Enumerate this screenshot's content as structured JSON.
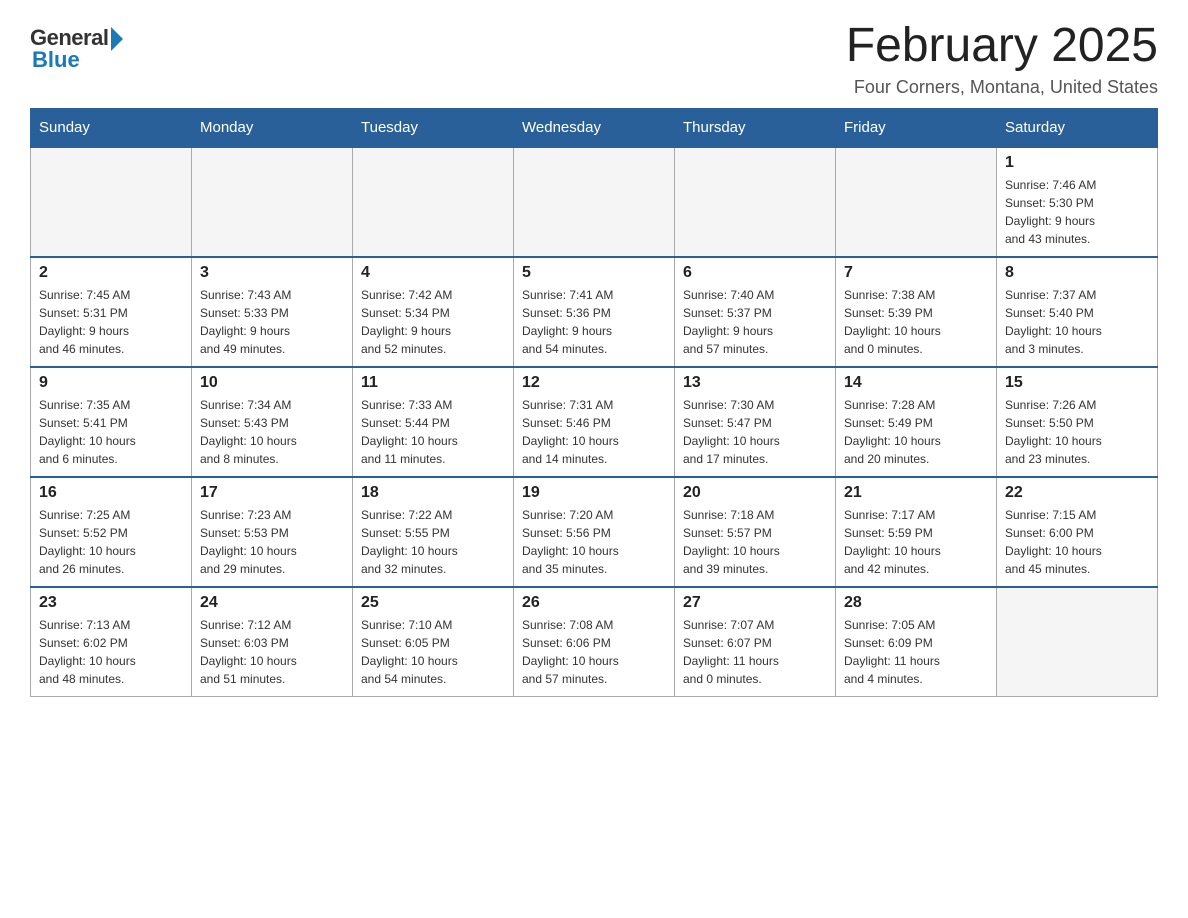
{
  "logo": {
    "general": "General",
    "blue": "Blue"
  },
  "title": "February 2025",
  "subtitle": "Four Corners, Montana, United States",
  "days_of_week": [
    "Sunday",
    "Monday",
    "Tuesday",
    "Wednesday",
    "Thursday",
    "Friday",
    "Saturday"
  ],
  "weeks": [
    [
      {
        "day": "",
        "info": ""
      },
      {
        "day": "",
        "info": ""
      },
      {
        "day": "",
        "info": ""
      },
      {
        "day": "",
        "info": ""
      },
      {
        "day": "",
        "info": ""
      },
      {
        "day": "",
        "info": ""
      },
      {
        "day": "1",
        "info": "Sunrise: 7:46 AM\nSunset: 5:30 PM\nDaylight: 9 hours\nand 43 minutes."
      }
    ],
    [
      {
        "day": "2",
        "info": "Sunrise: 7:45 AM\nSunset: 5:31 PM\nDaylight: 9 hours\nand 46 minutes."
      },
      {
        "day": "3",
        "info": "Sunrise: 7:43 AM\nSunset: 5:33 PM\nDaylight: 9 hours\nand 49 minutes."
      },
      {
        "day": "4",
        "info": "Sunrise: 7:42 AM\nSunset: 5:34 PM\nDaylight: 9 hours\nand 52 minutes."
      },
      {
        "day": "5",
        "info": "Sunrise: 7:41 AM\nSunset: 5:36 PM\nDaylight: 9 hours\nand 54 minutes."
      },
      {
        "day": "6",
        "info": "Sunrise: 7:40 AM\nSunset: 5:37 PM\nDaylight: 9 hours\nand 57 minutes."
      },
      {
        "day": "7",
        "info": "Sunrise: 7:38 AM\nSunset: 5:39 PM\nDaylight: 10 hours\nand 0 minutes."
      },
      {
        "day": "8",
        "info": "Sunrise: 7:37 AM\nSunset: 5:40 PM\nDaylight: 10 hours\nand 3 minutes."
      }
    ],
    [
      {
        "day": "9",
        "info": "Sunrise: 7:35 AM\nSunset: 5:41 PM\nDaylight: 10 hours\nand 6 minutes."
      },
      {
        "day": "10",
        "info": "Sunrise: 7:34 AM\nSunset: 5:43 PM\nDaylight: 10 hours\nand 8 minutes."
      },
      {
        "day": "11",
        "info": "Sunrise: 7:33 AM\nSunset: 5:44 PM\nDaylight: 10 hours\nand 11 minutes."
      },
      {
        "day": "12",
        "info": "Sunrise: 7:31 AM\nSunset: 5:46 PM\nDaylight: 10 hours\nand 14 minutes."
      },
      {
        "day": "13",
        "info": "Sunrise: 7:30 AM\nSunset: 5:47 PM\nDaylight: 10 hours\nand 17 minutes."
      },
      {
        "day": "14",
        "info": "Sunrise: 7:28 AM\nSunset: 5:49 PM\nDaylight: 10 hours\nand 20 minutes."
      },
      {
        "day": "15",
        "info": "Sunrise: 7:26 AM\nSunset: 5:50 PM\nDaylight: 10 hours\nand 23 minutes."
      }
    ],
    [
      {
        "day": "16",
        "info": "Sunrise: 7:25 AM\nSunset: 5:52 PM\nDaylight: 10 hours\nand 26 minutes."
      },
      {
        "day": "17",
        "info": "Sunrise: 7:23 AM\nSunset: 5:53 PM\nDaylight: 10 hours\nand 29 minutes."
      },
      {
        "day": "18",
        "info": "Sunrise: 7:22 AM\nSunset: 5:55 PM\nDaylight: 10 hours\nand 32 minutes."
      },
      {
        "day": "19",
        "info": "Sunrise: 7:20 AM\nSunset: 5:56 PM\nDaylight: 10 hours\nand 35 minutes."
      },
      {
        "day": "20",
        "info": "Sunrise: 7:18 AM\nSunset: 5:57 PM\nDaylight: 10 hours\nand 39 minutes."
      },
      {
        "day": "21",
        "info": "Sunrise: 7:17 AM\nSunset: 5:59 PM\nDaylight: 10 hours\nand 42 minutes."
      },
      {
        "day": "22",
        "info": "Sunrise: 7:15 AM\nSunset: 6:00 PM\nDaylight: 10 hours\nand 45 minutes."
      }
    ],
    [
      {
        "day": "23",
        "info": "Sunrise: 7:13 AM\nSunset: 6:02 PM\nDaylight: 10 hours\nand 48 minutes."
      },
      {
        "day": "24",
        "info": "Sunrise: 7:12 AM\nSunset: 6:03 PM\nDaylight: 10 hours\nand 51 minutes."
      },
      {
        "day": "25",
        "info": "Sunrise: 7:10 AM\nSunset: 6:05 PM\nDaylight: 10 hours\nand 54 minutes."
      },
      {
        "day": "26",
        "info": "Sunrise: 7:08 AM\nSunset: 6:06 PM\nDaylight: 10 hours\nand 57 minutes."
      },
      {
        "day": "27",
        "info": "Sunrise: 7:07 AM\nSunset: 6:07 PM\nDaylight: 11 hours\nand 0 minutes."
      },
      {
        "day": "28",
        "info": "Sunrise: 7:05 AM\nSunset: 6:09 PM\nDaylight: 11 hours\nand 4 minutes."
      },
      {
        "day": "",
        "info": ""
      }
    ]
  ]
}
